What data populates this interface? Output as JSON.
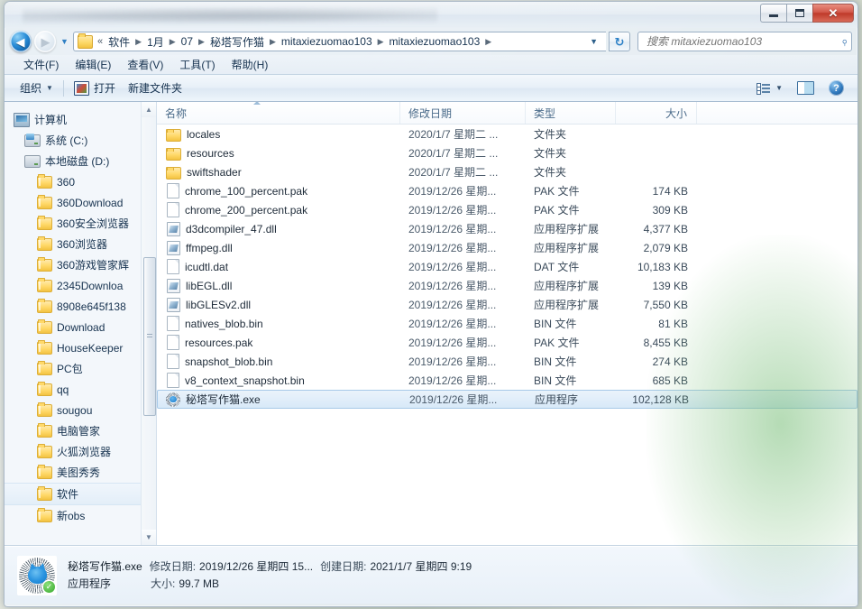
{
  "window": {
    "controls": {
      "minimize": "—",
      "maximize": "❐",
      "close": "✕"
    }
  },
  "address": {
    "back_label": "◀",
    "forward_label": "▶",
    "history_caret": "▼",
    "root_chevron": "«",
    "separator": "▶",
    "crumbs": [
      "软件",
      "1月",
      "07",
      "秘塔写作猫",
      "mitaxiezuomao103",
      "mitaxiezuomao103"
    ],
    "end_caret": "▼",
    "refresh_icon": "↻",
    "search_placeholder": "搜索 mitaxiezuomao103",
    "search_value": "",
    "search_icon": "⌕"
  },
  "menubar": {
    "items": [
      "文件(F)",
      "编辑(E)",
      "查看(V)",
      "工具(T)",
      "帮助(H)"
    ]
  },
  "toolbar": {
    "organize_label": "组织",
    "organize_caret": "▼",
    "open_label": "打开",
    "newfolder_label": "新建文件夹",
    "view_caret": "▼",
    "help_glyph": "?"
  },
  "navpane": {
    "items": [
      {
        "label": "计算机",
        "icon": "computer-icon",
        "level": 1
      },
      {
        "label": "系统 (C:)",
        "icon": "drive-system-icon",
        "level": 2
      },
      {
        "label": "本地磁盘 (D:)",
        "icon": "drive-icon",
        "level": 2
      },
      {
        "label": "360",
        "icon": "folder-icon",
        "level": 3
      },
      {
        "label": "360Download",
        "icon": "folder-icon",
        "level": 3
      },
      {
        "label": "360安全浏览器",
        "icon": "folder-icon",
        "level": 3
      },
      {
        "label": "360浏览器",
        "icon": "folder-icon",
        "level": 3
      },
      {
        "label": "360游戏管家辉",
        "icon": "folder-icon",
        "level": 3
      },
      {
        "label": "2345Downloa",
        "icon": "folder-icon",
        "level": 3
      },
      {
        "label": "8908e645f138",
        "icon": "folder-icon",
        "level": 3
      },
      {
        "label": "Download",
        "icon": "folder-icon",
        "level": 3
      },
      {
        "label": "HouseKeeper",
        "icon": "folder-icon",
        "level": 3
      },
      {
        "label": "PC包",
        "icon": "folder-icon",
        "level": 3
      },
      {
        "label": "qq",
        "icon": "folder-icon",
        "level": 3
      },
      {
        "label": "sougou",
        "icon": "folder-icon",
        "level": 3
      },
      {
        "label": "电脑管家",
        "icon": "folder-icon",
        "level": 3
      },
      {
        "label": "火狐浏览器",
        "icon": "folder-icon",
        "level": 3
      },
      {
        "label": "美图秀秀",
        "icon": "folder-icon",
        "level": 3
      },
      {
        "label": "软件",
        "icon": "folder-icon",
        "level": 3,
        "selected": true
      },
      {
        "label": "新obs",
        "icon": "folder-icon",
        "level": 3
      }
    ],
    "scroll_up": "▲",
    "scroll_down": "▼"
  },
  "filelist": {
    "columns": [
      "名称",
      "修改日期",
      "类型",
      "大小"
    ],
    "sorted_column": "名称",
    "rows": [
      {
        "name": "locales",
        "date": "2020/1/7 星期二 ...",
        "type": "文件夹",
        "size": "",
        "icon": "folder-icon"
      },
      {
        "name": "resources",
        "date": "2020/1/7 星期二 ...",
        "type": "文件夹",
        "size": "",
        "icon": "folder-icon"
      },
      {
        "name": "swiftshader",
        "date": "2020/1/7 星期二 ...",
        "type": "文件夹",
        "size": "",
        "icon": "folder-icon"
      },
      {
        "name": "chrome_100_percent.pak",
        "date": "2019/12/26 星期...",
        "type": "PAK 文件",
        "size": "174 KB",
        "icon": "file-icon"
      },
      {
        "name": "chrome_200_percent.pak",
        "date": "2019/12/26 星期...",
        "type": "PAK 文件",
        "size": "309 KB",
        "icon": "file-icon"
      },
      {
        "name": "d3dcompiler_47.dll",
        "date": "2019/12/26 星期...",
        "type": "应用程序扩展",
        "size": "4,377 KB",
        "icon": "dll-icon"
      },
      {
        "name": "ffmpeg.dll",
        "date": "2019/12/26 星期...",
        "type": "应用程序扩展",
        "size": "2,079 KB",
        "icon": "dll-icon"
      },
      {
        "name": "icudtl.dat",
        "date": "2019/12/26 星期...",
        "type": "DAT 文件",
        "size": "10,183 KB",
        "icon": "file-icon"
      },
      {
        "name": "libEGL.dll",
        "date": "2019/12/26 星期...",
        "type": "应用程序扩展",
        "size": "139 KB",
        "icon": "dll-icon"
      },
      {
        "name": "libGLESv2.dll",
        "date": "2019/12/26 星期...",
        "type": "应用程序扩展",
        "size": "7,550 KB",
        "icon": "dll-icon"
      },
      {
        "name": "natives_blob.bin",
        "date": "2019/12/26 星期...",
        "type": "BIN 文件",
        "size": "81 KB",
        "icon": "file-icon"
      },
      {
        "name": "resources.pak",
        "date": "2019/12/26 星期...",
        "type": "PAK 文件",
        "size": "8,455 KB",
        "icon": "file-icon"
      },
      {
        "name": "snapshot_blob.bin",
        "date": "2019/12/26 星期...",
        "type": "BIN 文件",
        "size": "274 KB",
        "icon": "file-icon"
      },
      {
        "name": "v8_context_snapshot.bin",
        "date": "2019/12/26 星期...",
        "type": "BIN 文件",
        "size": "685 KB",
        "icon": "file-icon"
      },
      {
        "name": "秘塔写作猫.exe",
        "date": "2019/12/26 星期...",
        "type": "应用程序",
        "size": "102,128 KB",
        "icon": "exe-icon",
        "selected": true
      }
    ]
  },
  "details": {
    "filename": "秘塔写作猫.exe",
    "modified_label": "修改日期:",
    "modified_value": "2019/12/26 星期四 15...",
    "created_label": "创建日期:",
    "created_value": "2021/1/7 星期四 9:19",
    "type_value": "应用程序",
    "size_label": "大小:",
    "size_value": "99.7 MB",
    "badge": "✓"
  }
}
